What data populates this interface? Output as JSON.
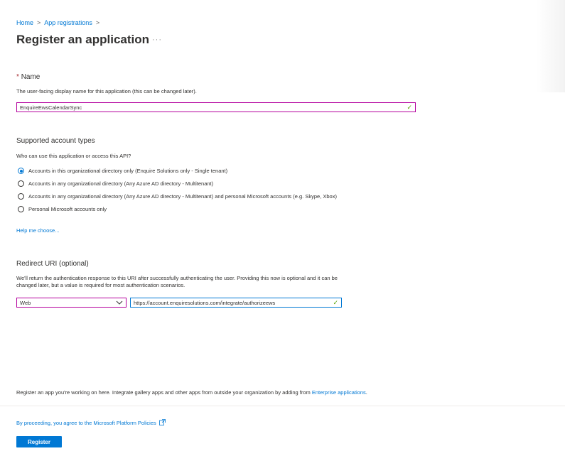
{
  "breadcrumb": {
    "home": "Home",
    "sep1": ">",
    "app_reg": "App registrations",
    "sep2": ">"
  },
  "page": {
    "title": "Register an application",
    "more": "···"
  },
  "name_section": {
    "required_mark": "*",
    "label": "Name",
    "description": "The user-facing display name for this application (this can be changed later).",
    "value": "EnquireEwsCalendarSync"
  },
  "account_types": {
    "label": "Supported account types",
    "question": "Who can use this application or access this API?",
    "options": [
      {
        "label": "Accounts in this organizational directory only (Enquire Solutions only - Single tenant)",
        "selected": true
      },
      {
        "label": "Accounts in any organizational directory (Any Azure AD directory - Multitenant)",
        "selected": false
      },
      {
        "label": "Accounts in any organizational directory (Any Azure AD directory - Multitenant) and personal Microsoft accounts (e.g. Skype, Xbox)",
        "selected": false
      },
      {
        "label": "Personal Microsoft accounts only",
        "selected": false
      }
    ],
    "help_link": "Help me choose..."
  },
  "redirect": {
    "label": "Redirect URI (optional)",
    "description_line1": "We'll return the authentication response to this URI after successfully authenticating the user. Providing this now is optional and it can be",
    "description_line2": "changed later, but a value is required for most authentication scenarios.",
    "platform": "Web",
    "uri": "https://account.enquiresolutions.com/integrate/authorizeews"
  },
  "footer": {
    "info_text": "Register an app you're working on here. Integrate gallery apps and other apps from outside your organization by adding from",
    "info_link": "Enterprise applications",
    "info_end": ".",
    "policy_link": "By proceeding, you agree to the Microsoft Platform Policies",
    "register_label": "Register"
  },
  "icons": {
    "check": "checkmark-icon",
    "chevron": "chevron-down-icon",
    "external": "external-link-icon"
  },
  "colors": {
    "accent": "#0078d4",
    "focus_border": "#b4009e",
    "valid": "#57a300",
    "required": "#a4262c"
  }
}
